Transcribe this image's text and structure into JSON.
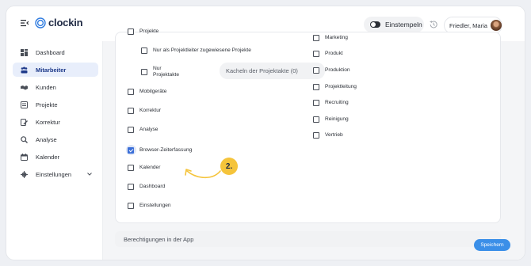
{
  "header": {
    "logo_text": "clockin",
    "stamp_label": "Einstempeln",
    "user_name": "Friedler, Maria"
  },
  "sidebar": {
    "items": [
      {
        "label": "Dashboard",
        "icon": "dashboard-icon"
      },
      {
        "label": "Mitarbeiter",
        "icon": "users-icon",
        "active": true
      },
      {
        "label": "Kunden",
        "icon": "handshake-icon"
      },
      {
        "label": "Projekte",
        "icon": "projects-icon"
      },
      {
        "label": "Korrektur",
        "icon": "correction-icon"
      },
      {
        "label": "Analyse",
        "icon": "analysis-icon"
      },
      {
        "label": "Kalender",
        "icon": "calendar-icon"
      },
      {
        "label": "Einstellungen",
        "icon": "settings-icon"
      }
    ]
  },
  "permissions": {
    "left": {
      "projekte": "Projekte",
      "nur_projektleiter": "Nur als Projektleiter zugewiesene Projekte",
      "nur_projektakte_line1": "Nur",
      "nur_projektakte_line2": "Projektakte",
      "projektakte_select": "Kacheln der Projektakte (0)",
      "mobilgeraete": "Mobilgeräte",
      "korrektur": "Korrektur",
      "analyse": "Analyse",
      "browser_zeiterfassung": "Browser-Zeiterfassung",
      "kalender": "Kalender",
      "dashboard": "Dashboard",
      "einstellungen": "Einstellungen"
    },
    "right": {
      "marketing": "Marketing",
      "produkt": "Produkt",
      "produktion": "Produktion",
      "projektleitung": "Projektleitung",
      "recruiting": "Recruiting",
      "reinigung": "Reinigung",
      "vertrieb": "Vertrieb"
    }
  },
  "annotation": {
    "step": "2."
  },
  "app_permissions_label": "Berechtigungen in der App",
  "save_label": "Speichern",
  "colors": {
    "accent": "#3b6fd8",
    "annotation": "#f5c43b",
    "save": "#3b8fe8"
  }
}
